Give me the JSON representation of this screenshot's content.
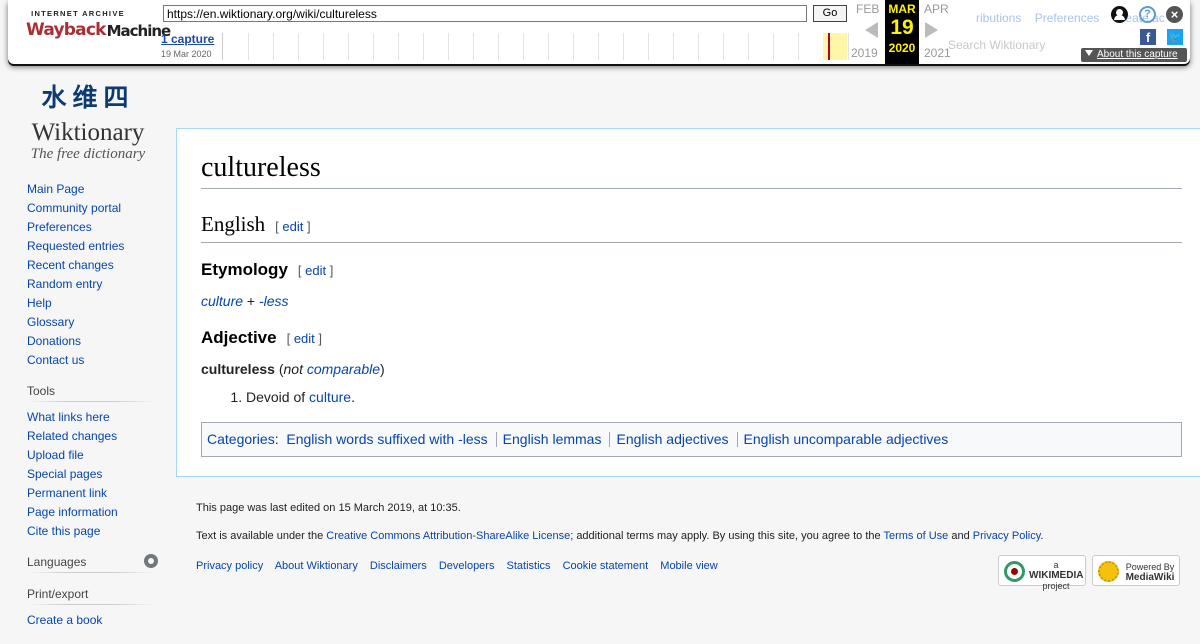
{
  "wayback": {
    "logo_top": "INTERNET ARCHIVE",
    "logo_wayback": "Wayback",
    "logo_machine": "Machine",
    "url": "https://en.wiktionary.org/wiki/cultureless",
    "go_label": "Go",
    "captures": "1 capture",
    "capture_range": "19 Mar 2020",
    "prev_month": "FEB",
    "cur_month": "MAR",
    "next_month": "APR",
    "cur_day": "19",
    "prev_year": "2019",
    "cur_year": "2020",
    "next_year": "2021",
    "about": "About this capture",
    "ghost_links": [
      "n",
      "ributions",
      "Preferences",
      "Create ac"
    ],
    "ghost_search": "Search Wiktionary",
    "colors": {
      "highlight": "#fff200",
      "capture": "#b3002d"
    }
  },
  "logo": {
    "glyphs": "水维四",
    "name": "Wiktionary",
    "tagline": "The free dictionary"
  },
  "sidebar": {
    "navigation": [
      "Main Page",
      "Community portal",
      "Preferences",
      "Requested entries",
      "Recent changes",
      "Random entry",
      "Help",
      "Glossary",
      "Donations",
      "Contact us"
    ],
    "tools_heading": "Tools",
    "tools": [
      "What links here",
      "Related changes",
      "Upload file",
      "Special pages",
      "Permanent link",
      "Page information",
      "Cite this page"
    ],
    "languages_heading": "Languages",
    "print_heading": "Print/export",
    "print_items": [
      "Create a book"
    ]
  },
  "page": {
    "title": "cultureless",
    "edit": "edit",
    "english_heading": "English",
    "etymology_heading": "Etymology",
    "etym_word1": "culture",
    "etym_plus": "+",
    "etym_word2": "-less",
    "adjective_heading": "Adjective",
    "headword": "cultureless",
    "not": "not",
    "comparable": "comparable",
    "definition_text": "Devoid of",
    "definition_link": "culture",
    "categories_label": "Categories",
    "categories": [
      "English words suffixed with -less",
      "English lemmas",
      "English adjectives",
      "English uncomparable adjectives"
    ]
  },
  "footer": {
    "last_edited": "This page was last edited on 15 March 2019, at 10:35.",
    "license_pre": "Text is available under the",
    "license_link": "Creative Commons Attribution-ShareAlike License",
    "license_mid": "; additional terms may apply. By using this site, you agree to the",
    "terms_link": "Terms of Use",
    "and": "and",
    "privacy_link": "Privacy Policy",
    "links": [
      "Privacy policy",
      "About Wiktionary",
      "Disclaimers",
      "Developers",
      "Statistics",
      "Cookie statement",
      "Mobile view"
    ],
    "wmf_small": "a",
    "wmf_name": "WIKIMEDIA",
    "wmf_sub": "project",
    "mw_small": "Powered By",
    "mw_name": "MediaWiki"
  }
}
